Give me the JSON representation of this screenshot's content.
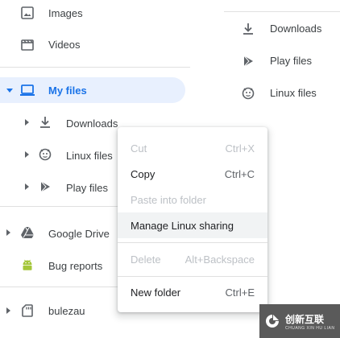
{
  "sidebar": {
    "items": [
      {
        "label": "Images",
        "icon": "image-icon"
      },
      {
        "label": "Videos",
        "icon": "video-icon"
      },
      {
        "label": "My files",
        "icon": "laptop-icon"
      },
      {
        "label": "Downloads",
        "icon": "download-icon"
      },
      {
        "label": "Linux files",
        "icon": "linux-icon"
      },
      {
        "label": "Play files",
        "icon": "play-icon"
      },
      {
        "label": "Google Drive",
        "icon": "drive-icon"
      },
      {
        "label": "Bug reports",
        "icon": "android-icon"
      },
      {
        "label": "bulezau",
        "icon": "sd-card-icon"
      }
    ]
  },
  "main": {
    "items": [
      {
        "label": "Downloads",
        "icon": "download-icon"
      },
      {
        "label": "Play files",
        "icon": "play-icon"
      },
      {
        "label": "Linux files",
        "icon": "linux-icon"
      }
    ]
  },
  "context_menu": {
    "items": [
      {
        "label": "Cut",
        "shortcut": "Ctrl+X",
        "disabled": true
      },
      {
        "label": "Copy",
        "shortcut": "Ctrl+C",
        "disabled": false
      },
      {
        "label": "Paste into folder",
        "shortcut": "",
        "disabled": true
      },
      {
        "label": "Manage Linux sharing",
        "shortcut": "",
        "disabled": false,
        "hovered": true
      },
      {
        "label": "Delete",
        "shortcut": "Alt+Backspace",
        "disabled": true
      },
      {
        "label": "New folder",
        "shortcut": "Ctrl+E",
        "disabled": false
      }
    ]
  },
  "watermark": {
    "text": "创新互联",
    "subtext": "CHUANG XIN HU LIAN"
  },
  "colors": {
    "accent": "#1a73e8",
    "selected_bg": "#e8f0fe",
    "icon_gray": "#5f6368",
    "android_green": "#a4c639"
  }
}
